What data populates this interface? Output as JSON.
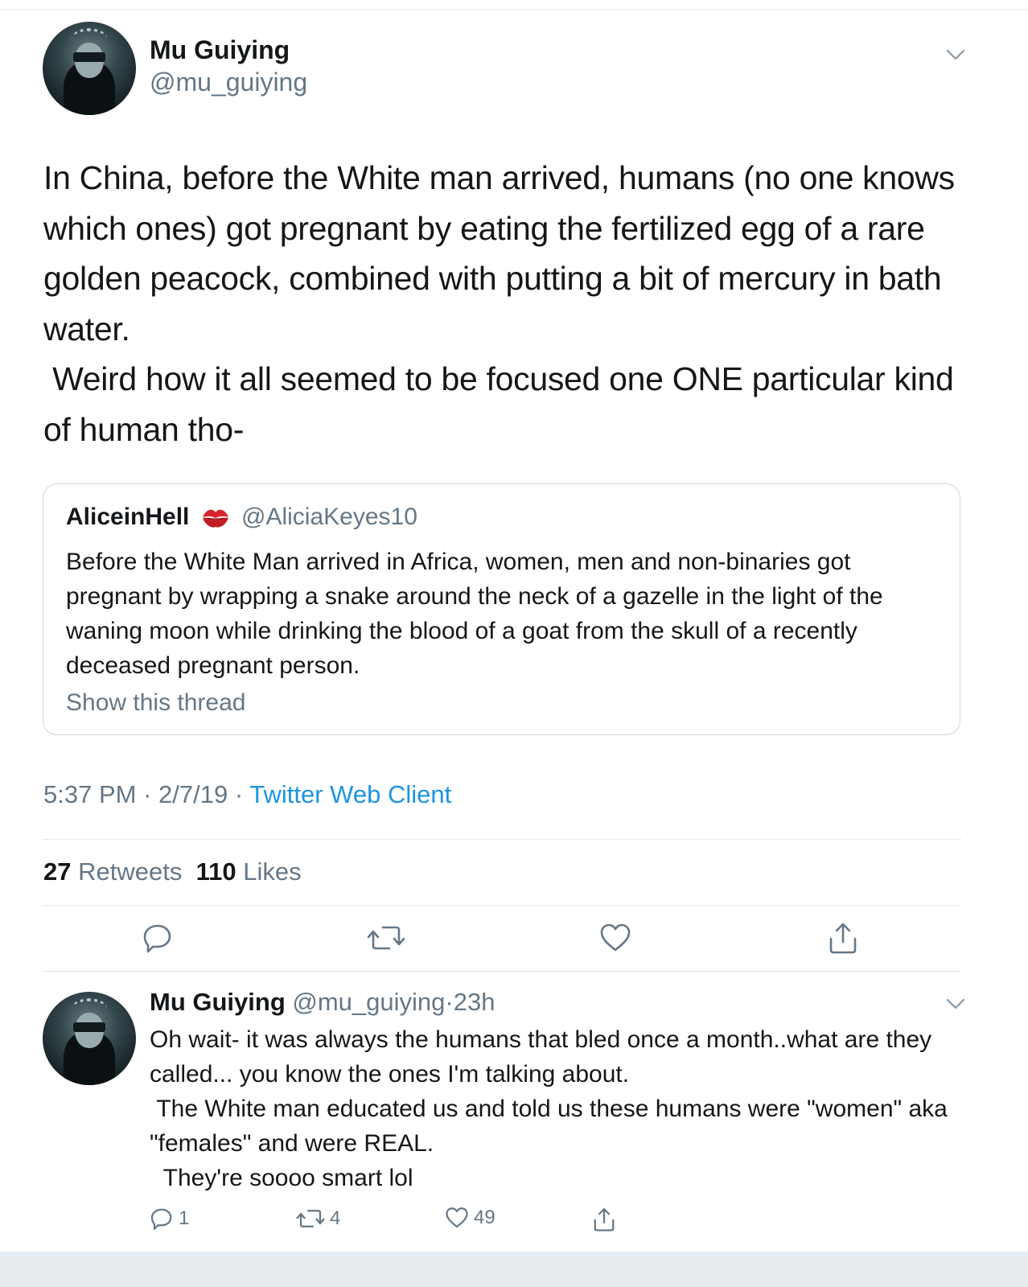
{
  "main_tweet": {
    "author_name": "Mu Guiying",
    "author_handle": "@mu_guiying",
    "text": "In China, before the White man arrived, humans (no one knows which ones) got pregnant by eating the fertilized egg of a rare golden peacock, combined with putting a bit of mercury in bath water.\n Weird how it all seemed to be focused one ONE particular kind of human tho-",
    "quote": {
      "author_name": "AliceinHell",
      "emoji_icon": "kiss-mark-icon",
      "author_handle": "@AliciaKeyes10",
      "text": "Before the White Man arrived in Africa, women, men and non-binaries got pregnant by wrapping a snake around the neck of a gazelle in the light of the waning moon while drinking the blood of a goat from the skull of a recently deceased pregnant person.",
      "show_thread": "Show this thread"
    },
    "time": "5:37 PM",
    "date": "2/7/19",
    "dot": "·",
    "client": "Twitter Web Client",
    "retweets_count": "27",
    "retweets_label": "Retweets",
    "likes_count": "110",
    "likes_label": "Likes"
  },
  "reply_tweet": {
    "author_name": "Mu Guiying",
    "author_handle": "@mu_guiying",
    "age": "23h",
    "text": "Oh wait- it was always the humans that bled once a month..what are they called... you know the ones I'm talking about.\n The White man educated us and told us these humans were \"women\" aka \"females\" and were REAL.\n  They're soooo smart lol",
    "reply_count": "1",
    "retweet_count": "4",
    "like_count": "49"
  },
  "colors": {
    "text": "#14171a",
    "secondary": "#657786",
    "link": "#1b95e0",
    "border": "#e1e8ed"
  }
}
